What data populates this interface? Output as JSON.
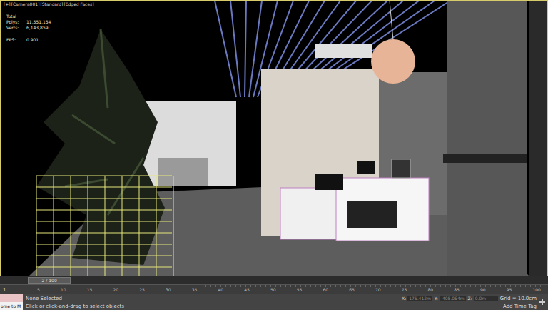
{
  "viewport": {
    "labels": [
      "[+]",
      "[Camera001]",
      "[Standard]",
      "[Edged Faces]"
    ],
    "active": true,
    "stats": {
      "title": "Total",
      "rows": [
        {
          "label": "Polys:",
          "value": "11,551,154"
        },
        {
          "label": "Verts:",
          "value": "6,143,859"
        }
      ],
      "fps": {
        "label": "FPS:",
        "value": "0.901"
      }
    }
  },
  "time_slider": {
    "label": "2 / 100",
    "level": 0.02
  },
  "ruler": {
    "left_marker": "1",
    "ticks": [
      "5",
      "10",
      "15",
      "20",
      "25",
      "30",
      "35",
      "40",
      "45",
      "50",
      "55",
      "60",
      "65",
      "70",
      "75",
      "80",
      "85",
      "90",
      "95",
      "100"
    ]
  },
  "status_bar": {
    "listener": "ome to M",
    "prompt": "None Selected",
    "hint": "Click or click-and-drag to select objects",
    "coords": [
      {
        "axis": "X:",
        "value": "175.412m"
      },
      {
        "axis": "Y:",
        "value": "-405.064m"
      },
      {
        "axis": "Z:",
        "value": "0.0m"
      }
    ],
    "grid": "Grid = 10.0cm",
    "time_tag": "Add Time Tag"
  }
}
